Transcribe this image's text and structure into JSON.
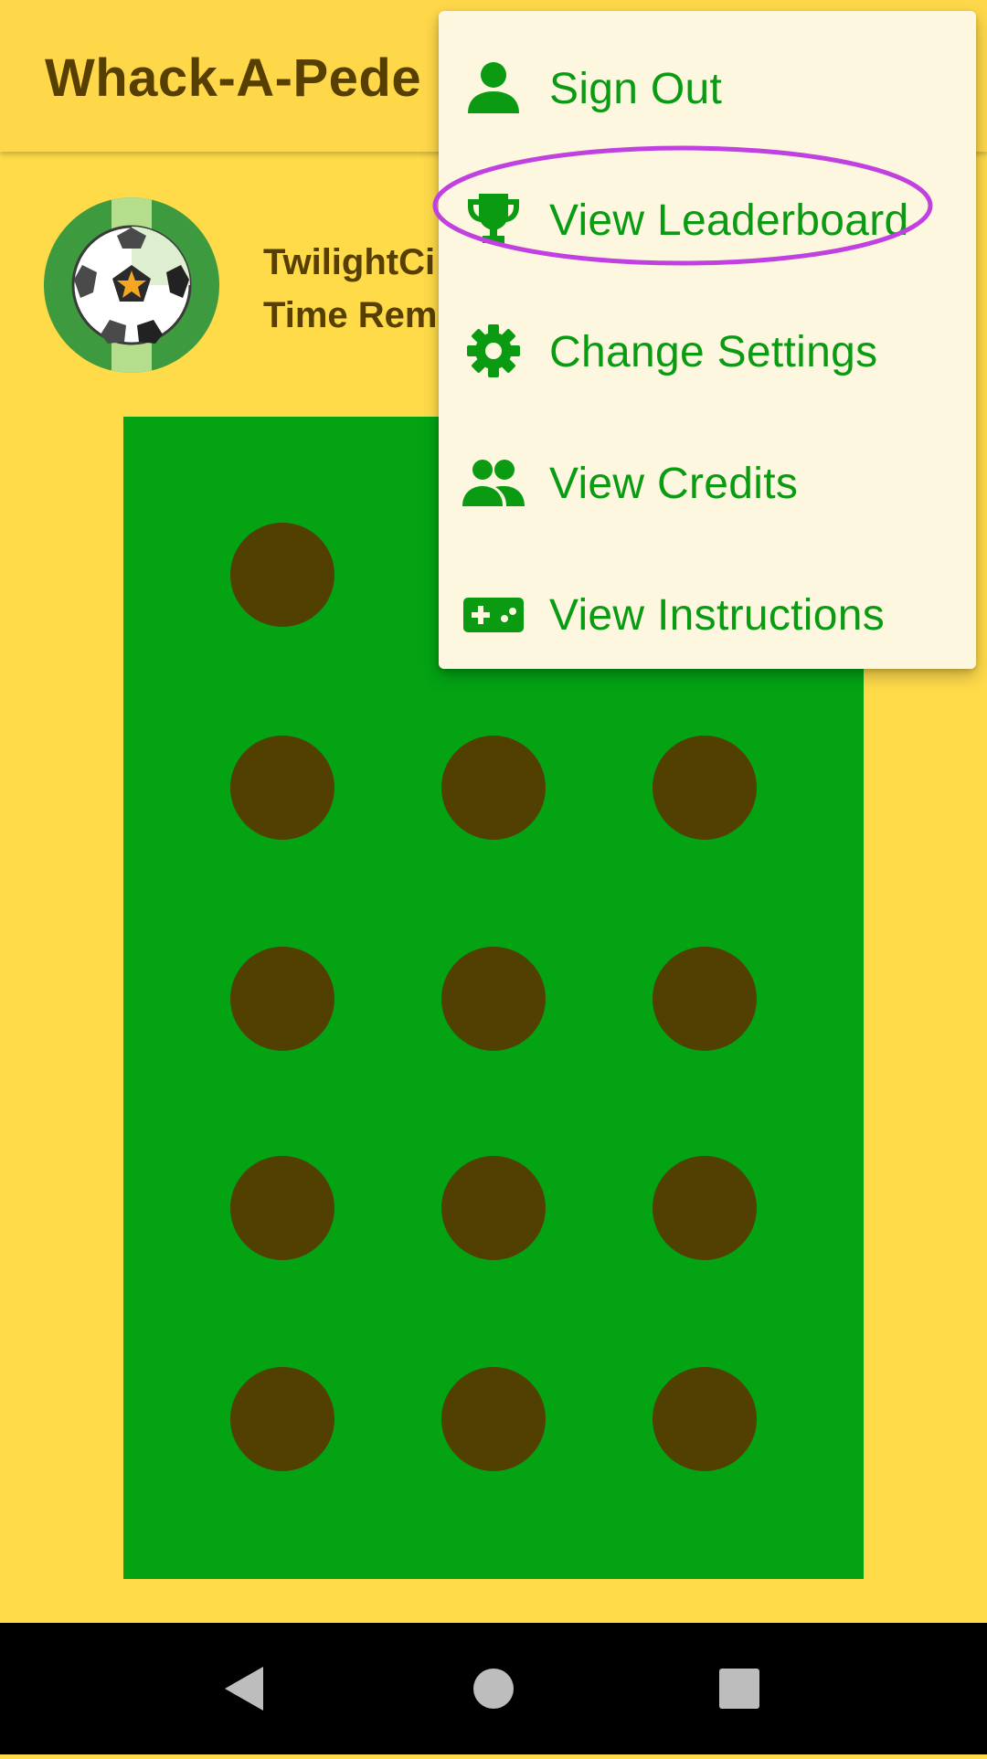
{
  "app": {
    "title": "Whack-A-Pede"
  },
  "player": {
    "name_line": "TwilightCi",
    "time_line": "Time Rem"
  },
  "avatar": {
    "icon": "soccer-ball-avatar-icon"
  },
  "menu": {
    "items": [
      {
        "label": "Sign Out",
        "icon": "person-icon"
      },
      {
        "label": "View Leaderboard",
        "icon": "trophy-icon"
      },
      {
        "label": "Change Settings",
        "icon": "gear-icon"
      },
      {
        "label": "View Credits",
        "icon": "people-icon"
      },
      {
        "label": "View Instructions",
        "icon": "gamepad-icon"
      }
    ],
    "highlighted_item": "View Leaderboard"
  },
  "colors": {
    "background": "#FFDB4A",
    "field": "#03A314",
    "hole": "#523F02",
    "menu_text": "#0A9B12",
    "highlight_ring": "#C040E0"
  }
}
